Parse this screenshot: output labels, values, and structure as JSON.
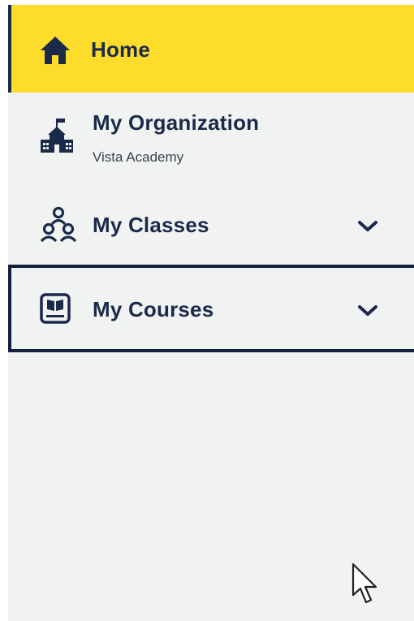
{
  "nav": {
    "items": [
      {
        "id": "home",
        "label": "Home",
        "icon": "home-icon",
        "active": true
      },
      {
        "id": "organization",
        "label": "My Organization",
        "sublabel": "Vista Academy",
        "icon": "school-icon"
      },
      {
        "id": "classes",
        "label": "My Classes",
        "icon": "users-group-icon",
        "expandable": true
      },
      {
        "id": "courses",
        "label": "My Courses",
        "icon": "course-book-icon",
        "expandable": true,
        "focused": true
      }
    ]
  },
  "colors": {
    "active_bg": "#fddc2c",
    "panel_bg": "#f1f3f3",
    "text": "#1b2a4a",
    "focus_border": "#14213d"
  }
}
